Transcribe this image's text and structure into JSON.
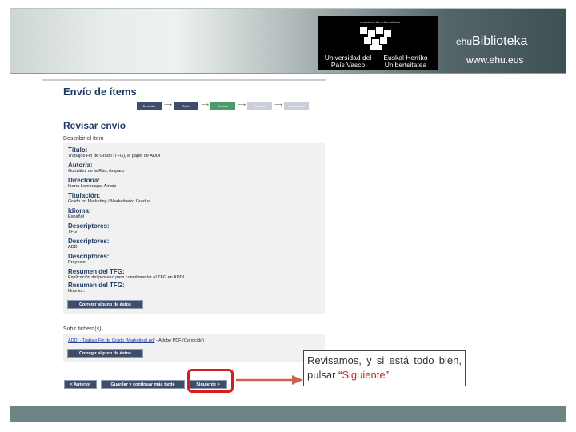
{
  "banner": {
    "logo_small": "euskal herriko unibertsitatea",
    "logo_line1": "Universidad del País Vasco",
    "logo_line2": "Euskal Herriko Unibertsitatea",
    "brand_prefix": "ehu",
    "brand_name": "Biblioteka",
    "url": "www.ehu.eus"
  },
  "page": {
    "title": "Envío de ítems",
    "steps": [
      "Describir",
      "Subir",
      "Revisar",
      "Licencia",
      "Completado"
    ],
    "review_title": "Revisar envío",
    "section_describe": "Describir el ítem",
    "fields": [
      {
        "label": "Título:",
        "value": "Trabajos Fin de Grado (TFG), el papel de ADDI"
      },
      {
        "label": "Autor/a:",
        "value": "González de la Rúa, Amparo"
      },
      {
        "label": "Director/a:",
        "value": "Ibarra Lamiruaga, Amaia"
      },
      {
        "label": "Titulación:",
        "value": "Grado en Marketing / Marketineko Gradua"
      },
      {
        "label": "Idioma:",
        "value": "Español"
      },
      {
        "label": "Descriptores:",
        "value": "TFG"
      },
      {
        "label": "Descriptores:",
        "value": "ADDI"
      },
      {
        "label": "Descriptores:",
        "value": "Proyecto"
      },
      {
        "label": "Resumen del TFG:",
        "value": "Explicación del proceso para cumplimentar el TFG en ADDI"
      },
      {
        "label": "Resumen del TFG:",
        "value": "How to..."
      }
    ],
    "correct_describe_btn": "Corregir alguno de éstos",
    "section_upload": "Subir fichero(s)",
    "file_link": "ADDI - Trabajo Fin de Grado (Marketing).pdf",
    "file_info": " - Adobe PDF (Conocido)",
    "correct_upload_btn": "Corregir alguno de éstos",
    "btn_prev": "< Anterior",
    "btn_save": "Guardar y continuar más tarde",
    "btn_next": "Siguiente >"
  },
  "callout": {
    "text": "Revisamos, y si está todo bien, pulsar “",
    "highlight": "Siguiente",
    "end": "”"
  },
  "colors": {
    "step_done": "#3e4e6a",
    "step_current": "#4d9a6a",
    "step_pending": "#c9cfd8",
    "highlight_red": "#d61e1e",
    "arrow": "#c8674e"
  }
}
